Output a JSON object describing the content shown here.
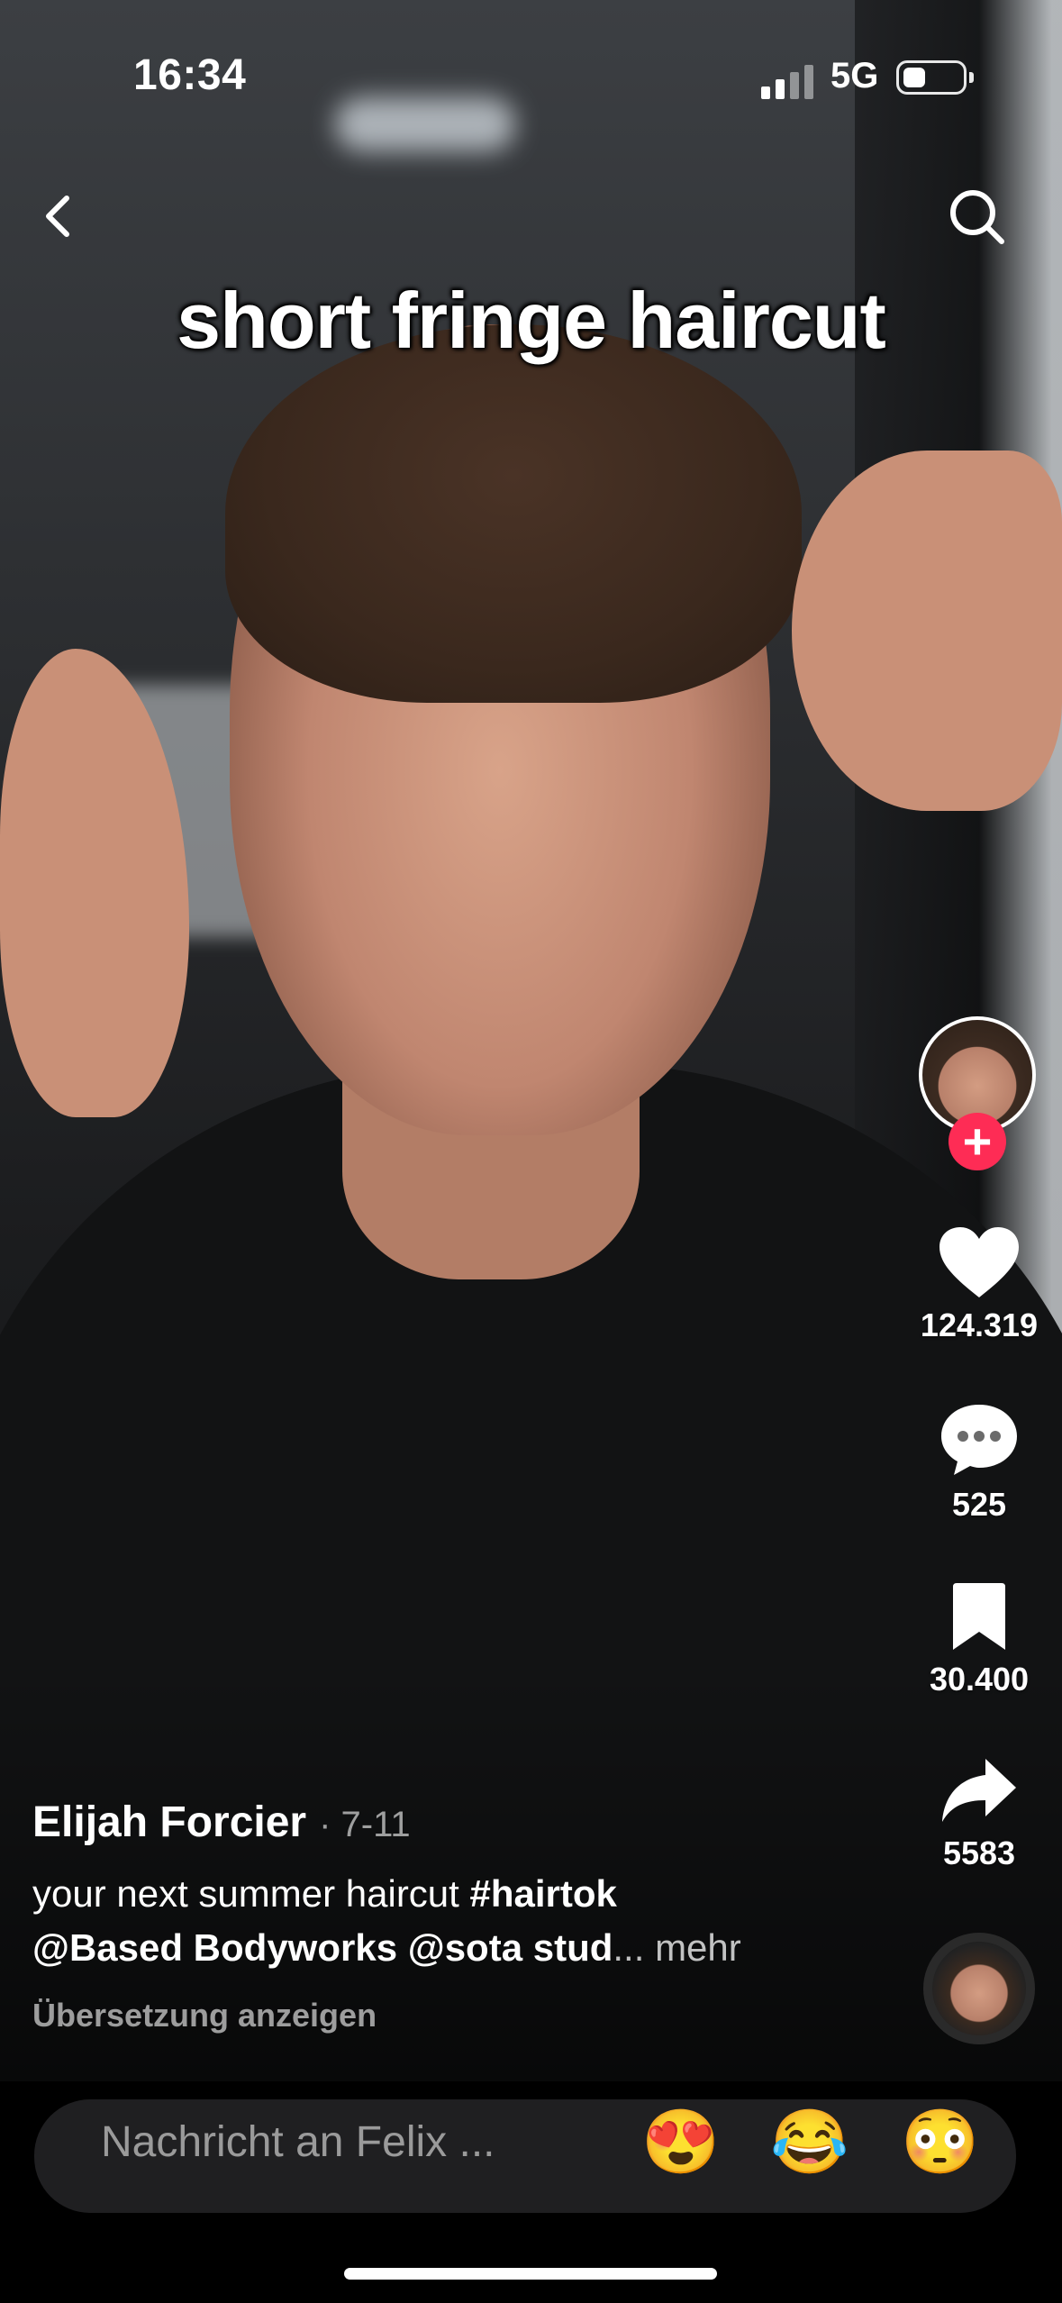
{
  "status_bar": {
    "time": "16:34",
    "network": "5G"
  },
  "overlay_text": "short fringe haircut",
  "rail": {
    "likes": "124.319",
    "comments": "525",
    "saves": "30.400",
    "shares": "5583",
    "follow_symbol": "+"
  },
  "post": {
    "author": "Elijah Forcier",
    "date": "· 7-11",
    "text": "your next summer haircut ",
    "hashtag": "#hairtok",
    "mentions": "@Based Bodyworks @sota stud",
    "more": "... mehr",
    "translate": "Übersetzung anzeigen"
  },
  "message": {
    "placeholder": "Nachricht an Felix ...",
    "emoji": [
      "😍",
      "😂",
      "😳"
    ]
  },
  "colors": {
    "accent": "#fe2c55",
    "bar": "#1f1f21"
  }
}
